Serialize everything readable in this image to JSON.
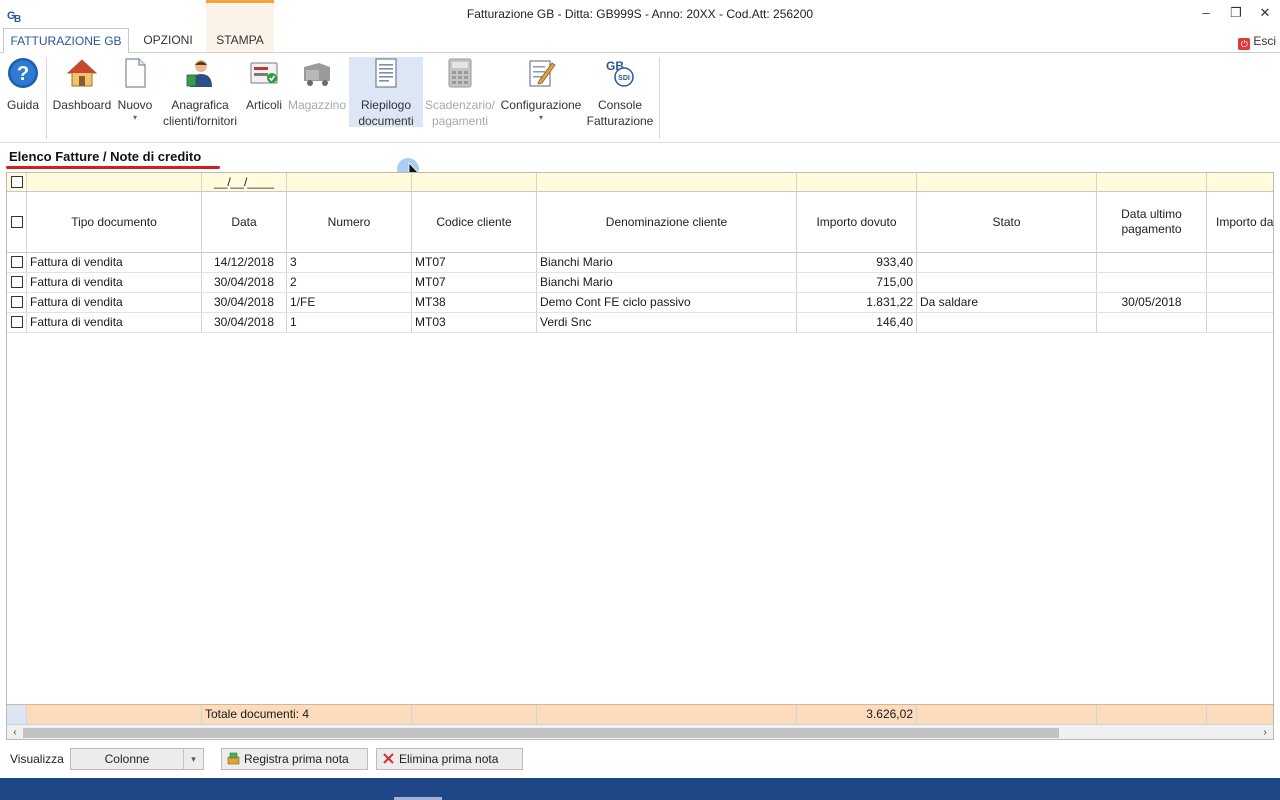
{
  "window": {
    "title": "Fatturazione GB - Ditta: GB999S - Anno: 20XX - Cod.Att: 256200",
    "minimize_glyph": "–",
    "restore_glyph": "❐",
    "close_glyph": "✕"
  },
  "tabs": [
    {
      "label": "FATTURAZIONE GB",
      "active": true
    },
    {
      "label": "OPZIONI",
      "active": false
    },
    {
      "label": "STAMPA",
      "active": false
    }
  ],
  "exit_label": "Esci",
  "ribbon": {
    "guida": "Guida",
    "dashboard": "Dashboard",
    "nuovo": "Nuovo",
    "anagrafica_1": "Anagrafica",
    "anagrafica_2": "clienti/fornitori",
    "articoli": "Articoli",
    "magazzino": "Magazzino",
    "riepilogo_1": "Riepilogo",
    "riepilogo_2": "documenti",
    "scadenzario_1": "Scadenzario/",
    "scadenzario_2": "pagamenti",
    "configurazione": "Configurazione",
    "console_1": "Console",
    "console_2": "Fatturazione",
    "sdi_badge": "SDI",
    "dropdown_caret": "▾"
  },
  "section_title": "Elenco Fatture / Note di credito",
  "filter": {
    "date_placeholder": "__/__/____"
  },
  "columns": {
    "tipo": "Tipo documento",
    "data": "Data",
    "numero": "Numero",
    "codice": "Codice cliente",
    "denominazione": "Denominazione cliente",
    "importo": "Importo dovuto",
    "stato": "Stato",
    "data_ultimo_1": "Data ultimo",
    "data_ultimo_2": "pagamento",
    "importo_da": "Importo da"
  },
  "rows": [
    {
      "tipo": "Fattura di vendita",
      "data": "14/12/2018",
      "numero": "3",
      "codice": "MT07",
      "denominazione": "Bianchi Mario",
      "importo": "933,40",
      "stato": "",
      "data_ultimo": "",
      "importo_da": ""
    },
    {
      "tipo": "Fattura di vendita",
      "data": "30/04/2018",
      "numero": "2",
      "codice": "MT07",
      "denominazione": "Bianchi Mario",
      "importo": "715,00",
      "stato": "",
      "data_ultimo": "",
      "importo_da": ""
    },
    {
      "tipo": "Fattura di vendita",
      "data": "30/04/2018",
      "numero": "1/FE",
      "codice": "MT38",
      "denominazione": "Demo Cont FE ciclo passivo",
      "importo": "1.831,22",
      "stato": "Da saldare",
      "data_ultimo": "30/05/2018",
      "importo_da": ""
    },
    {
      "tipo": "Fattura di vendita",
      "data": "30/04/2018",
      "numero": "1",
      "codice": "MT03",
      "denominazione": "Verdi Snc",
      "importo": "146,40",
      "stato": "",
      "data_ultimo": "",
      "importo_da": ""
    }
  ],
  "totals": {
    "count_label": "Totale documenti: 4",
    "importo_total": "3.626,02"
  },
  "scroll": {
    "left_glyph": "‹",
    "right_glyph": "›"
  },
  "footer": {
    "visualizza_label": "Visualizza",
    "view_value": "Colonne",
    "view_caret": "▾",
    "registra_label": "Registra prima nota",
    "elimina_label": "Elimina prima nota"
  },
  "colors": {
    "accent": "#2b579a",
    "filter_row": "#fffbdc",
    "total_row": "#fcdcbd",
    "underline": "#d21f1f",
    "taskbar": "#1f4788"
  }
}
